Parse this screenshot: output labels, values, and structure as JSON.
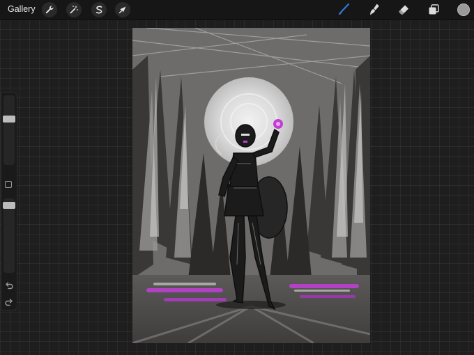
{
  "topbar": {
    "gallery_label": "Gallery",
    "left_tools": [
      {
        "name": "actions",
        "icon": "wrench-icon"
      },
      {
        "name": "adjustments",
        "icon": "magic-wand-icon"
      },
      {
        "name": "selection",
        "icon": "selection-s-icon"
      },
      {
        "name": "transform",
        "icon": "arrow-cursor-icon"
      }
    ],
    "right_tools": [
      {
        "name": "brush",
        "icon": "brush-icon",
        "active": true
      },
      {
        "name": "smudge",
        "icon": "smudge-icon"
      },
      {
        "name": "eraser",
        "icon": "eraser-icon"
      },
      {
        "name": "layers",
        "icon": "layers-icon"
      }
    ],
    "current_color": "#9a9a9a",
    "accent_color": "#2f7bd8"
  },
  "sidebar": {
    "brush_size_level": 0.68,
    "opacity_level": 0.95,
    "icons": [
      "modifier-square-icon",
      "undo-icon",
      "redo-icon"
    ]
  },
  "artwork": {
    "description_colors": [
      "#6e6c6a",
      "#d6d6d6",
      "#1a1a1a",
      "#c23fd6"
    ]
  }
}
